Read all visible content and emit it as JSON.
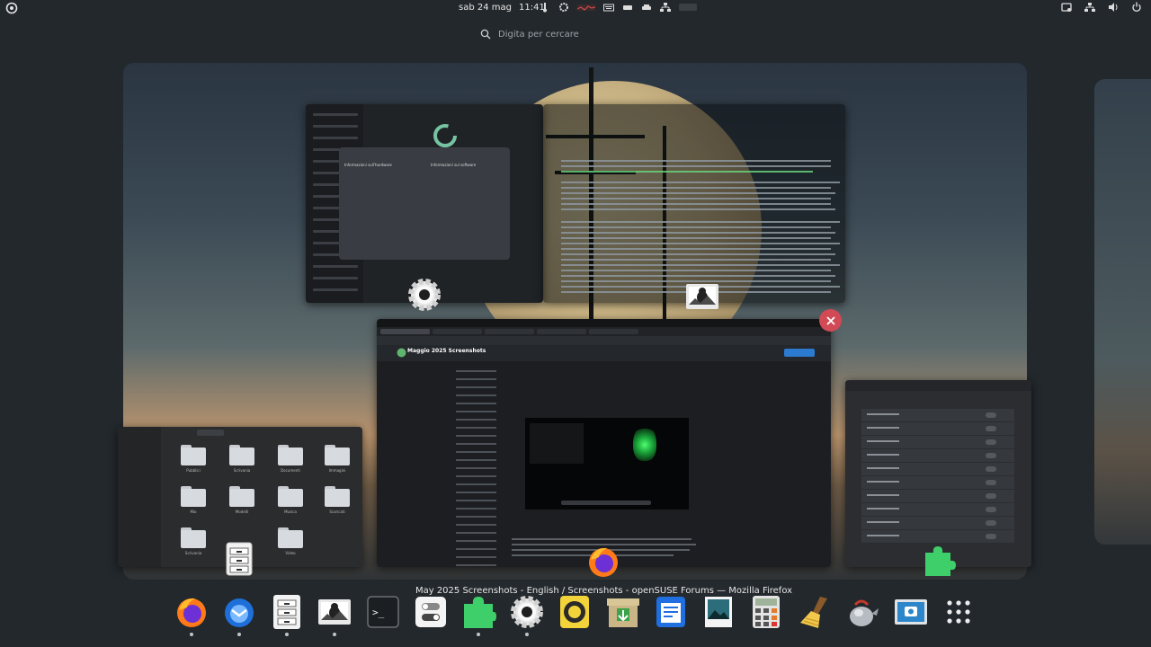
{
  "topbar": {
    "date": "sab 24 mag",
    "time": "11:41",
    "indicator_icons": [
      "thermometer-icon",
      "gear-sync-icon",
      "cpu-graph-icon",
      "keyboard-icon",
      "disk-icon",
      "car-icon",
      "network-tree-icon"
    ],
    "status_icons": [
      "screenshot-icon",
      "network-icon",
      "volume-icon",
      "power-icon"
    ]
  },
  "search": {
    "placeholder": "Digita per cercare"
  },
  "windows": {
    "settings": {
      "dialog_left_title": "Informazioni sull'hardware",
      "dialog_right_title": "Informazioni sul software"
    },
    "firefox": {
      "page_title": "Maggio 2025 Screenshots"
    },
    "files": {
      "folders": [
        "Pubblici",
        "Scrivania",
        "Documenti",
        "Immagini",
        "Mio",
        "Modelli",
        "Musica",
        "Scaricati",
        "Scrivania",
        "Video"
      ]
    }
  },
  "tooltip": "May 2025 Screenshots - English / Screenshots - openSUSE Forums — Mozilla Firefox",
  "dock": {
    "apps": [
      "firefox-icon",
      "thunderbird-icon",
      "file-cabinet-icon",
      "tux-screenshot-icon",
      "terminal-icon",
      "tweaks-icon",
      "extensions-icon",
      "settings-icon",
      "speaker-icon",
      "archive-manager-icon",
      "text-editor-icon",
      "image-viewer-icon",
      "calculator-icon",
      "cleaner-icon",
      "tea-kettle-icon",
      "screenshot-camera-icon",
      "app-grid-icon"
    ],
    "terminal_prompt": ">_"
  }
}
